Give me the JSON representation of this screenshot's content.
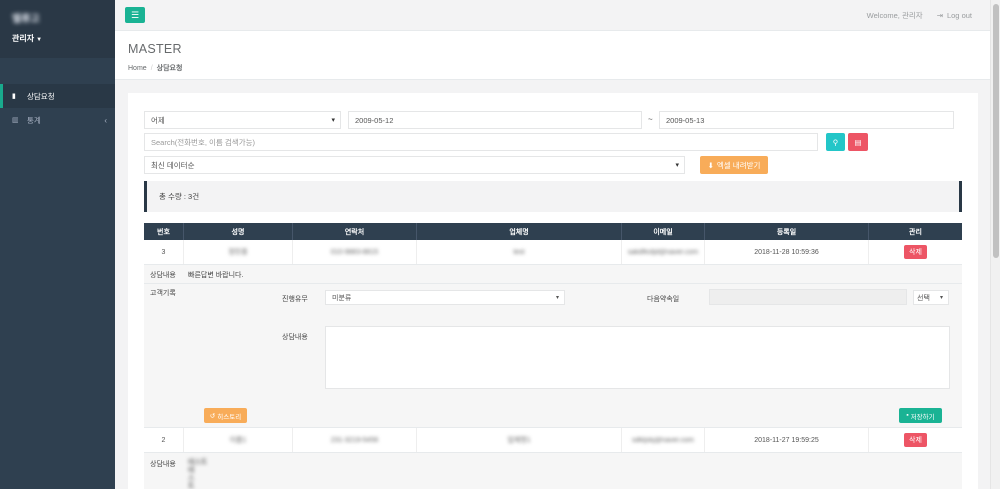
{
  "sidebar": {
    "logo": "밸류고",
    "user": "관리자",
    "items": [
      {
        "label": "상담요청",
        "icon": "book-icon",
        "active": true
      },
      {
        "label": "통계",
        "icon": "bar-chart-icon",
        "active": false
      }
    ]
  },
  "topbar": {
    "welcome": "Welcome, 관리자",
    "logout": "Log out"
  },
  "heading": {
    "title": "MASTER",
    "crumb_home": "Home",
    "crumb_current": "상담요청"
  },
  "filters": {
    "period": "어제",
    "date_from": "2009-05-12",
    "tilde": "~",
    "date_to": "2009-05-13",
    "search_placeholder": "Search(전화번호, 이름 검색가능)",
    "sort": "최신 데이터순",
    "excel_label": "엑셀 내려받기"
  },
  "summary": "총 수량 : 3건",
  "table": {
    "headers": [
      "번호",
      "성명",
      "연락처",
      "업체명",
      "이메일",
      "등록일",
      "관리"
    ],
    "rows": [
      {
        "no": "3",
        "name": "정민중",
        "phone": "010-9883-8815",
        "company": "test",
        "email": "sakdfksfjd@naver.com",
        "date": "2018-11-28 10:59:36",
        "action": "삭제"
      },
      {
        "no": "2",
        "name": "이름1",
        "phone": "231-3219-5456",
        "company": "업체명1",
        "email": "sdkljskj@naver.com",
        "date": "2018-11-27 19:59:25",
        "action": "삭제"
      }
    ]
  },
  "detail1": {
    "content_label": "상담내용",
    "content": "빠른답변 바랍니다.",
    "record_label": "고객기록",
    "status_label": "진행유무",
    "status_value": "미분류",
    "next_label": "다음약속일",
    "choose": "선택",
    "memo_label": "상담내용",
    "history_btn": "히스토리",
    "save_btn": "저장하기"
  },
  "detail2": {
    "content_label": "상담내용",
    "lines": [
      "테스트",
      "테",
      "스",
      "트"
    ]
  }
}
